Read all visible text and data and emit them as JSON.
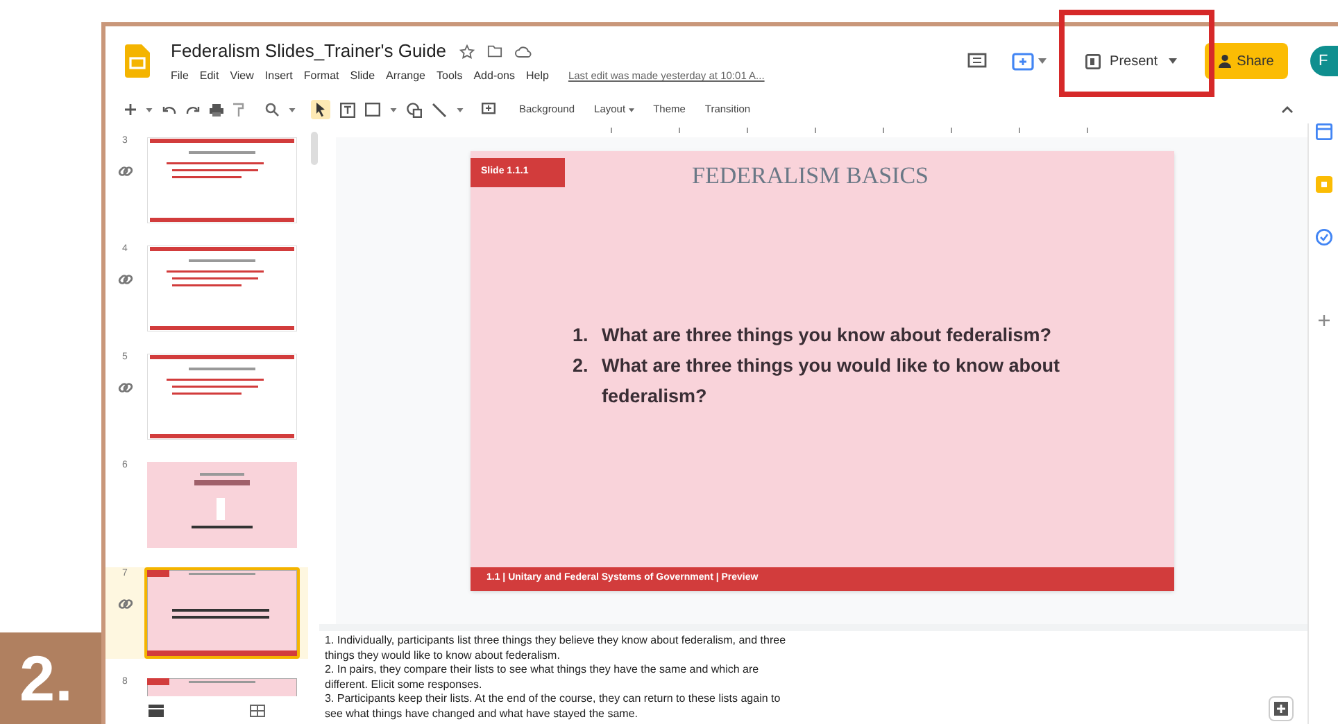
{
  "step": {
    "label": "2."
  },
  "document": {
    "title": "Federalism Slides_Trainer's Guide",
    "starred": false
  },
  "menus": [
    "File",
    "Edit",
    "View",
    "Insert",
    "Format",
    "Slide",
    "Arrange",
    "Tools",
    "Add-ons",
    "Help"
  ],
  "last_edit": "Last edit was made yesterday at 10:01 A...",
  "present_button": {
    "label": "Present",
    "highlighted": true
  },
  "share_button": {
    "label": "Share"
  },
  "avatar": {
    "initial": "F"
  },
  "toolbar": [
    {
      "label": "Background",
      "dropdown": false
    },
    {
      "label": "Layout",
      "dropdown": true
    },
    {
      "label": "Theme",
      "dropdown": false
    },
    {
      "label": "Transition",
      "dropdown": false
    }
  ],
  "filmstrip": [
    {
      "number": "3",
      "kind": "text",
      "linked": true,
      "selected": false
    },
    {
      "number": "4",
      "kind": "text",
      "linked": true,
      "selected": false
    },
    {
      "number": "5",
      "kind": "text",
      "linked": true,
      "selected": false
    },
    {
      "number": "6",
      "kind": "title",
      "linked": false,
      "selected": false
    },
    {
      "number": "7",
      "kind": "question",
      "linked": true,
      "selected": true
    },
    {
      "number": "8",
      "kind": "question",
      "linked": false,
      "selected": false
    }
  ],
  "slide": {
    "tag": "Slide 1.1.1",
    "title": "FEDERALISM BASICS",
    "questions": [
      {
        "number": "1.",
        "text": "What are three things you know about federalism?"
      },
      {
        "number": "2.",
        "text": "What are three things you would like to know about federalism?"
      }
    ],
    "footer": "1.1 | Unitary and Federal Systems of Government  | Preview"
  },
  "notes": [
    "1. Individually, participants list three things they believe they know about federalism, and three things they would like to know about federalism.",
    "2. In pairs, they compare their lists to see what things they have the same and which are different. Elicit some responses.",
    "3. Participants keep their lists. At the end of the course, they can return to these lists again to see what things have changed and what have stayed the same."
  ]
}
